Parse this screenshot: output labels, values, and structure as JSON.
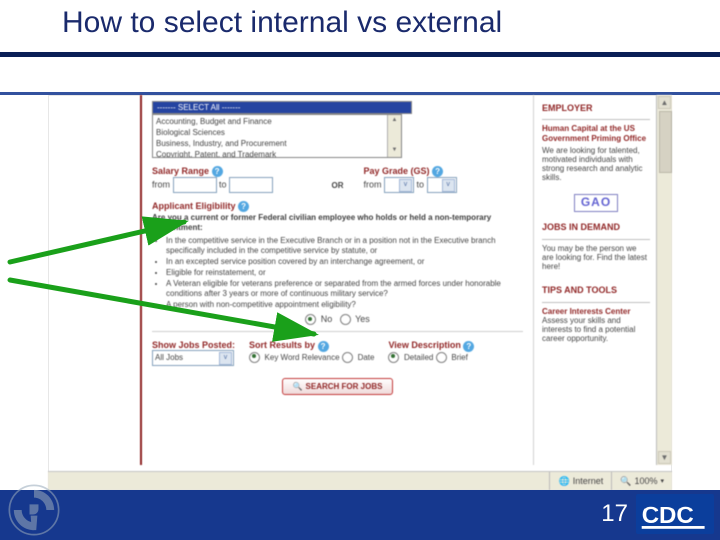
{
  "slide": {
    "title": "How to select internal vs external",
    "page_number": "17"
  },
  "colors": {
    "title": "#1a2a6c",
    "rule_dark": "#0a1f56",
    "rule_light": "#32519e",
    "footer_bg": "#16388e",
    "maroon": "#8a1a1a",
    "arrow": "#1aa01a"
  },
  "screenshot": {
    "listbox": {
      "selected_row": "------- SELECT All -------",
      "options": [
        "Accounting, Budget and Finance",
        "Biological Sciences",
        "Business, Industry, and Procurement",
        "Copyright, Patent, and Trademark"
      ]
    },
    "salary": {
      "label": "Salary Range",
      "from": "from",
      "to": "to"
    },
    "paygrade": {
      "label": "Pay Grade (GS)",
      "from": "from",
      "to": "to"
    },
    "or": "OR",
    "eligibility": {
      "label": "Applicant Eligibility",
      "question": "Are you a current or former Federal civilian employee who holds or held a non-temporary appointment:",
      "bullets": [
        "In the competitive service in the Executive Branch or in a position not in the Executive branch specifically included in the competitive service by statute, or",
        "In an excepted service position covered by an interchange agreement, or",
        "Eligible for reinstatement, or",
        "A Veteran eligible for veterans preference or separated from the armed forces under honorable conditions after 3 years or more of continuous military service?",
        "A person with non-competitive appointment eligibility?"
      ],
      "no": "No",
      "yes": "Yes"
    },
    "show": {
      "label": "Show Jobs Posted:",
      "value": "All Jobs"
    },
    "sort": {
      "label": "Sort Results by",
      "opt1": "Key Word Relevance",
      "opt2": "Date"
    },
    "view": {
      "label": "View Description",
      "opt1": "Detailed",
      "opt2": "Brief"
    },
    "search_button": "SEARCH FOR JOBS",
    "sidebar": {
      "employer_head": "EMPLOYER",
      "employer_sub": "Human Capital at the US Government Priming Office",
      "employer_body": "We are looking for talented, motivated individuals with strong research and analytic skills.",
      "gao": "GAO",
      "jobs_head": "JOBS IN DEMAND",
      "jobs_body": "You may be the person we are looking for. Find the latest here!",
      "tips_head": "TIPS AND TOOLS",
      "tips_sub": "Career Interests Center",
      "tips_body": "Assess your skills and interests to find a potential career opportunity."
    },
    "statusbar": {
      "internet": "Internet",
      "zoom": "100%"
    }
  }
}
